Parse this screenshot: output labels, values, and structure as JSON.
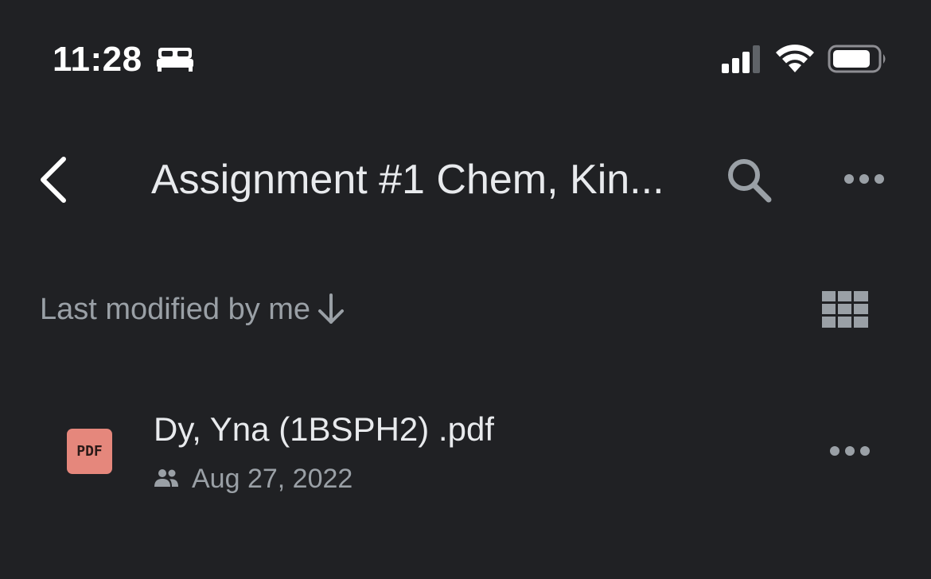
{
  "status_bar": {
    "time": "11:28",
    "icons": [
      "sleep-icon",
      "signal-icon",
      "wifi-icon",
      "battery-icon"
    ]
  },
  "header": {
    "title": "Assignment #1 Chem, Kin...",
    "icons": [
      "back-icon",
      "search-icon",
      "more-icon"
    ]
  },
  "sort": {
    "label": "Last modified by me",
    "direction_icon": "arrow-down-icon",
    "view_toggle_icon": "grid-view-icon"
  },
  "files": [
    {
      "name": "Dy, Yna (1BSPH2) .pdf",
      "type_badge": "PDF",
      "shared_icon": "people-icon",
      "date": "Aug 27, 2022"
    }
  ],
  "colors": {
    "background": "#202124",
    "primary_text": "#e8eaed",
    "secondary_text": "#9aa0a6",
    "pdf_badge": "#e5877c"
  }
}
